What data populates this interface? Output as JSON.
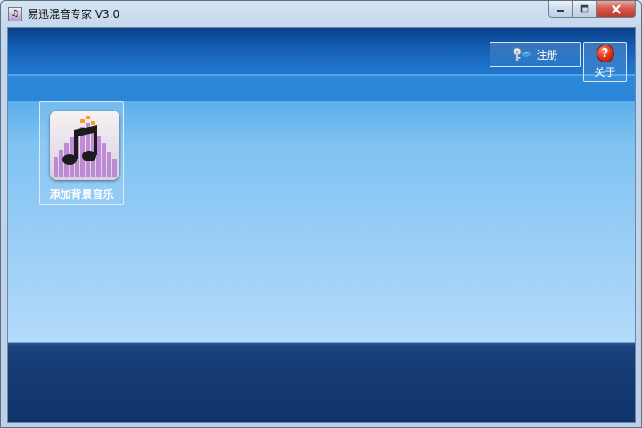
{
  "window": {
    "title": "易迅混音专家 V3.0",
    "app_icon": "music-note-icon"
  },
  "caption": {
    "minimize": "minimize-icon",
    "maximize": "restore-icon",
    "close": "close-icon"
  },
  "toolbar": {
    "register_label": "注册",
    "register_icon": "key-icon",
    "about_label": "关于",
    "about_icon": "help-icon"
  },
  "main": {
    "add_music_label": "添加背景音乐",
    "add_music_icon": "music-equalizer-icon"
  },
  "colors": {
    "header": "#0a3f86",
    "content": "#7fc2f2",
    "footer": "#153a72",
    "close": "#c0392b"
  }
}
